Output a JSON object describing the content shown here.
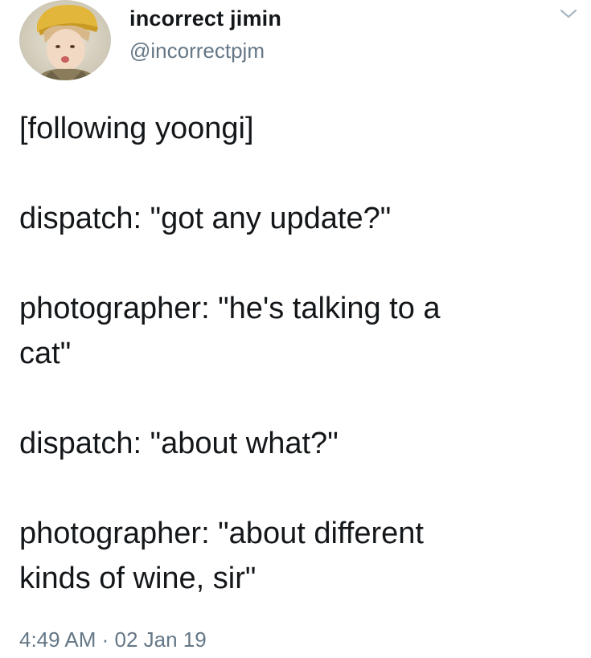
{
  "tweet": {
    "display_name": "incorrect jimin",
    "handle": "@incorrectpjm",
    "lines": [
      "[following yoongi]",
      "dispatch: \"got any update?\"",
      "photographer: \"he's talking to a",
      "cat\"",
      "dispatch: \"about what?\"",
      "photographer: \"about different",
      "kinds of wine, sir\""
    ],
    "timestamp": "4:49 AM · 02 Jan 19"
  },
  "icons": {
    "menu": "chevron-down-icon",
    "avatar": "avatar"
  },
  "colors": {
    "text": "#14171a",
    "secondary_text": "#657786",
    "background": "#ffffff"
  }
}
